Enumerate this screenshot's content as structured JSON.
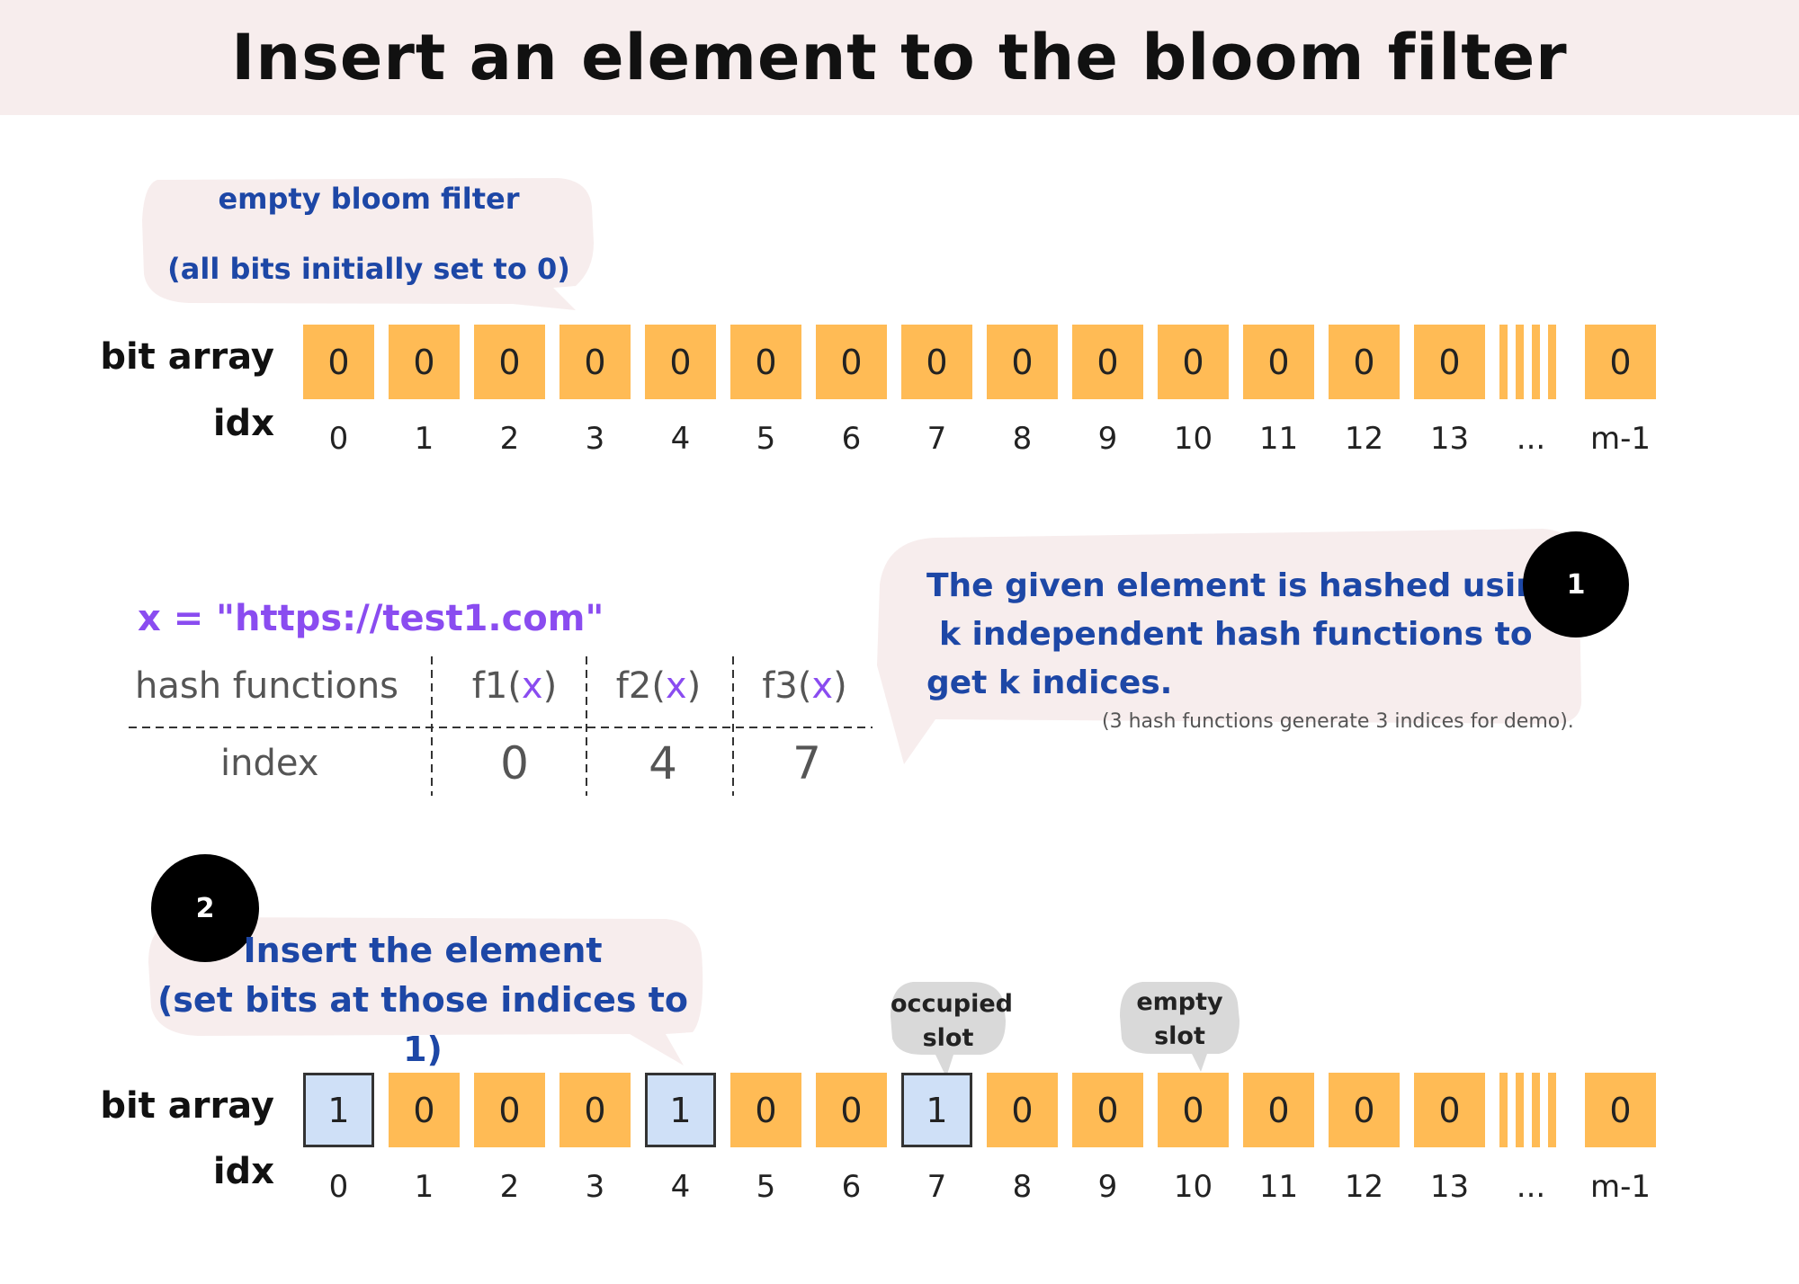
{
  "title": "Insert an element to the bloom filter",
  "top": {
    "note_line1": "empty bloom filter",
    "note_line2": "(all bits initially set to 0)",
    "bit_array_label": "bit array",
    "idx_label": "idx",
    "bits": [
      "0",
      "0",
      "0",
      "0",
      "0",
      "0",
      "0",
      "0",
      "0",
      "0",
      "0",
      "0",
      "0",
      "0"
    ],
    "indices": [
      "0",
      "1",
      "2",
      "3",
      "4",
      "5",
      "6",
      "7",
      "8",
      "9",
      "10",
      "11",
      "12",
      "13"
    ],
    "ellipsis": "...",
    "last_bit": "0",
    "last_index": "m-1"
  },
  "hashing": {
    "x_expression": "x = \"https://test1.com\"",
    "hash_functions_label": "hash functions",
    "index_label": "index",
    "functions": [
      {
        "name": "f1",
        "open": "(",
        "arg": "x",
        "close": ")",
        "index": "0"
      },
      {
        "name": "f2",
        "open": "(",
        "arg": "x",
        "close": ")",
        "index": "4"
      },
      {
        "name": "f3",
        "open": "(",
        "arg": "x",
        "close": ")",
        "index": "7"
      }
    ],
    "step_number": "1",
    "explain_line1": "The given element is hashed using",
    "explain_line2": "k independent hash functions to",
    "explain_line3": "get k indices.",
    "demo_note": "(3 hash  functions generate 3 indices for demo)."
  },
  "bottom": {
    "step_number": "2",
    "note_line1": "Insert the element",
    "note_line2": "(set bits at those indices to 1)",
    "occupied_tag_line1": "occupied",
    "occupied_tag_line2": "slot",
    "empty_tag_line1": "empty",
    "empty_tag_line2": "slot",
    "bit_array_label": "bit array",
    "idx_label": "idx",
    "bits": [
      "1",
      "0",
      "0",
      "0",
      "1",
      "0",
      "0",
      "1",
      "0",
      "0",
      "0",
      "0",
      "0",
      "0"
    ],
    "indices": [
      "0",
      "1",
      "2",
      "3",
      "4",
      "5",
      "6",
      "7",
      "8",
      "9",
      "10",
      "11",
      "12",
      "13"
    ],
    "ellipsis": "...",
    "last_bit": "0",
    "last_index": "m-1"
  },
  "colors": {
    "empty_bit": "#ffbb55",
    "set_bit": "#cfe0f7",
    "note_text": "#1d47a6",
    "highlight": "#8a4cf0",
    "bubble": "#f7eded",
    "tag_bubble": "#d9d9d9"
  }
}
